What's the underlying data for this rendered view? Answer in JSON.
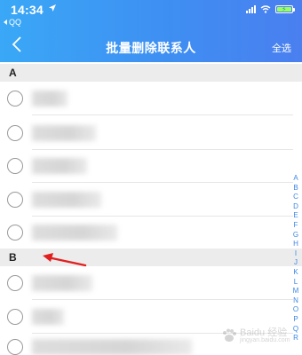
{
  "status_bar": {
    "time": "14:34",
    "back_app": "QQ"
  },
  "nav": {
    "title": "批量删除联系人",
    "select_all": "全选"
  },
  "sections": [
    {
      "letter": "A",
      "contact_count": 5
    },
    {
      "letter": "B",
      "contact_count": 3
    }
  ],
  "alphabet_index": [
    "A",
    "B",
    "C",
    "D",
    "E",
    "F",
    "G",
    "H",
    "I",
    "J",
    "K",
    "L",
    "M",
    "N",
    "O",
    "P",
    "Q",
    "R"
  ],
  "watermark": {
    "text": "Baidu 经验",
    "url": "jingyan.baidu.com"
  },
  "colors": {
    "header_start": "#3aa8f6",
    "header_end": "#4a7ff0",
    "section_bg": "#ececec",
    "index_color": "#3b86e6",
    "arrow_color": "#e02020"
  }
}
